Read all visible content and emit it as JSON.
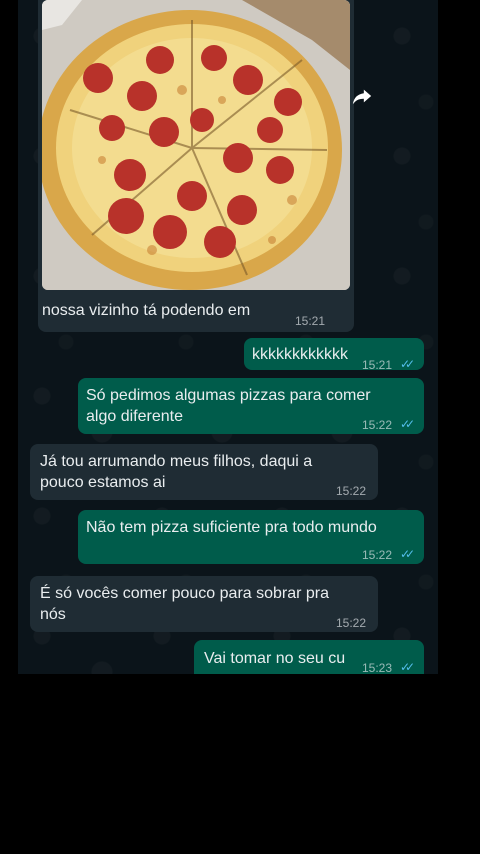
{
  "messages": [
    {
      "dir": "in",
      "text": "nossa vizinho tá podendo em",
      "time": "15:21",
      "has_photo": true
    },
    {
      "dir": "out",
      "text": "kkkkkkkkkkkk",
      "time": "15:21"
    },
    {
      "dir": "out",
      "text": [
        "Só pedimos algumas pizzas para comer",
        "algo diferente"
      ],
      "time": "15:22"
    },
    {
      "dir": "in",
      "text": [
        "Já tou arrumando meus filhos, daqui a",
        "pouco estamos ai"
      ],
      "time": "15:22"
    },
    {
      "dir": "out",
      "text": "Não tem pizza suficiente pra todo mundo",
      "time": "15:22"
    },
    {
      "dir": "in",
      "text": [
        "É só vocês comer pouco para sobrar pra",
        "nós"
      ],
      "time": "15:22"
    },
    {
      "dir": "out",
      "text": "Vai tomar no seu cu",
      "time": "15:23"
    }
  ],
  "icons": {
    "forward": "forward-arrow-icon",
    "read_receipt": "double-check-icon",
    "photo": "pizza-photo"
  },
  "colors": {
    "incoming": "#1f2c34",
    "outgoing": "#005c4b",
    "ticks": "#53bdeb",
    "background": "#0b141a"
  }
}
